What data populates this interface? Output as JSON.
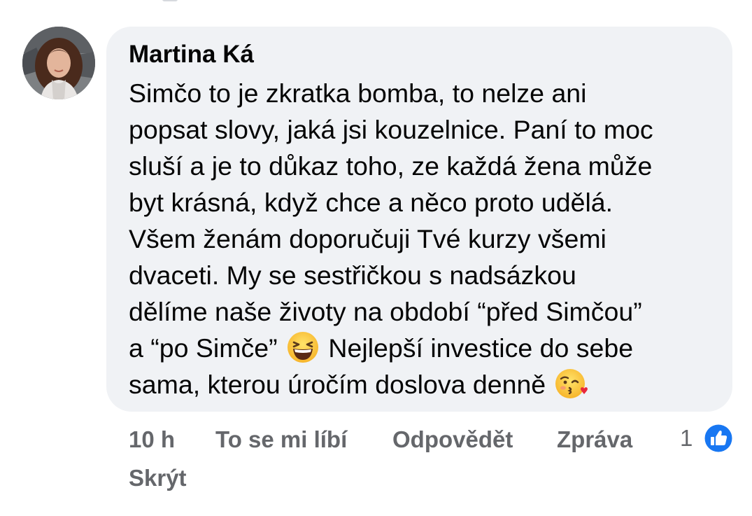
{
  "comment": {
    "author": "Martina Ká",
    "lines": [
      "Simčo to je zkratka bomba, to nelze ani",
      "popsat slovy, jaká jsi kouzelnice. Paní to moc",
      "sluší a je to důkaz toho, ze každá žena může",
      "byt krásná, když chce a něco proto udělá.",
      "Všem ženám doporučuji Tvé kurzy všemi",
      "dvaceti. My se sestřičkou s nadsázkou",
      "dělíme naše životy na období “před Simčou”"
    ],
    "line8_before_emoji": "a “po Simče”",
    "line8_after_emoji": "Nejlepší investice do sebe",
    "line9_before_emoji": "sama, kterou úročím doslova denně",
    "emoji_1": "grinning-squinting-face-icon",
    "emoji_2": "face-blowing-kiss-icon"
  },
  "actions": {
    "time": "10 h",
    "like": "To se mi líbí",
    "reply": "Odpovědět",
    "report": "Zpráva",
    "hide": "Skrýt"
  },
  "reactions": {
    "count": "1",
    "icon": "thumbs-up-icon",
    "badge_color": "#1877f2"
  },
  "colors": {
    "bubble": "#f0f2f5",
    "text": "#050505",
    "secondary": "#65676b"
  }
}
